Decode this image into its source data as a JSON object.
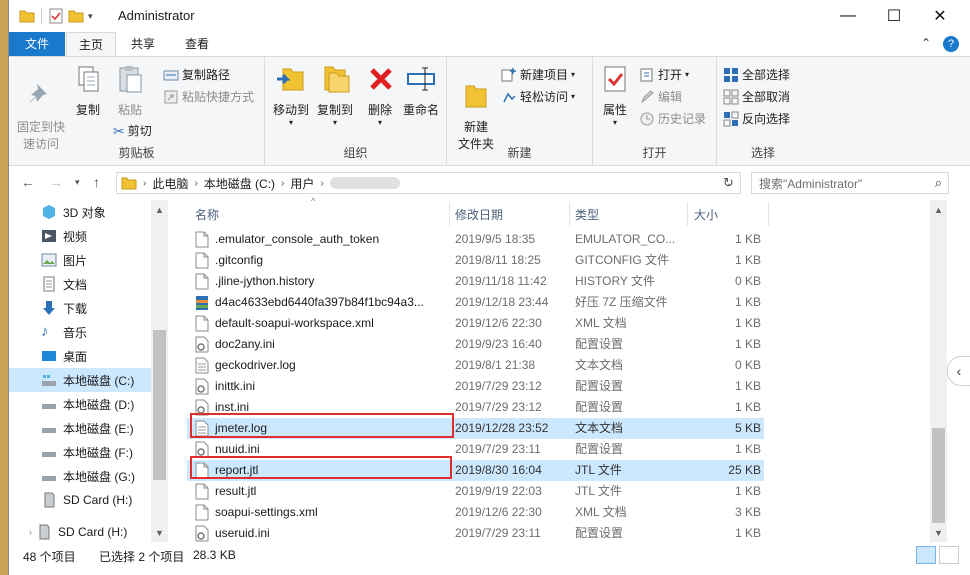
{
  "window": {
    "title": "Administrator",
    "minimize": "—",
    "maximize": "☐",
    "close": "✕"
  },
  "ribbon_tabs": {
    "file": "文件",
    "home": "主页",
    "share": "共享",
    "view": "查看"
  },
  "ribbon": {
    "clipboard": {
      "label": "剪贴板",
      "pin": "固定到快\n速访问",
      "copy": "复制",
      "paste": "粘贴",
      "copy_path": "复制路径",
      "paste_shortcut": "粘贴快捷方式",
      "cut": "剪切"
    },
    "organize": {
      "label": "组织",
      "move_to": "移动到",
      "copy_to": "复制到",
      "delete": "删除",
      "rename": "重命名"
    },
    "new": {
      "label": "新建",
      "new_folder": "新建\n文件夹",
      "new_item": "新建项目",
      "easy_access": "轻松访问"
    },
    "open": {
      "label": "打开",
      "properties": "属性",
      "open": "打开",
      "edit": "编辑",
      "history": "历史记录"
    },
    "select": {
      "label": "选择",
      "select_all": "全部选择",
      "select_none": "全部取消",
      "invert": "反向选择"
    }
  },
  "address": {
    "crumbs": [
      "此电脑",
      "本地磁盘 (C:)",
      "用户"
    ],
    "search_placeholder": "搜索\"Administrator\""
  },
  "nav_items": [
    {
      "label": "3D 对象",
      "icon": "3d-objects-icon"
    },
    {
      "label": "视频",
      "icon": "video-folder-icon"
    },
    {
      "label": "图片",
      "icon": "pictures-folder-icon"
    },
    {
      "label": "文档",
      "icon": "documents-folder-icon"
    },
    {
      "label": "下载",
      "icon": "downloads-folder-icon"
    },
    {
      "label": "音乐",
      "icon": "music-folder-icon"
    },
    {
      "label": "桌面",
      "icon": "desktop-folder-icon"
    },
    {
      "label": "本地磁盘 (C:)",
      "icon": "drive-c-icon"
    },
    {
      "label": "本地磁盘 (D:)",
      "icon": "drive-icon"
    },
    {
      "label": "本地磁盘 (E:)",
      "icon": "drive-icon"
    },
    {
      "label": "本地磁盘 (F:)",
      "icon": "drive-icon"
    },
    {
      "label": "本地磁盘 (G:)",
      "icon": "drive-icon"
    },
    {
      "label": "SD Card (H:)",
      "icon": "sd-card-icon"
    },
    {
      "label": "SD Card (H:)",
      "icon": "sd-card-icon"
    }
  ],
  "columns": {
    "name": "名称",
    "date": "修改日期",
    "type": "类型",
    "size": "大小"
  },
  "files": [
    {
      "name": ".emulator_console_auth_token",
      "date": "2019/9/5 18:35",
      "type": "EMULATOR_CO...",
      "size": "1 KB",
      "icon": "file-icon"
    },
    {
      "name": ".gitconfig",
      "date": "2019/8/11 18:25",
      "type": "GITCONFIG 文件",
      "size": "1 KB",
      "icon": "file-icon"
    },
    {
      "name": ".jline-jython.history",
      "date": "2019/11/18 11:42",
      "type": "HISTORY 文件",
      "size": "0 KB",
      "icon": "file-icon"
    },
    {
      "name": "d4ac4633ebd6440fa397b84f1bc94a3...",
      "date": "2019/12/18 23:44",
      "type": "好压 7Z 压缩文件",
      "size": "1 KB",
      "icon": "archive-icon"
    },
    {
      "name": "default-soapui-workspace.xml",
      "date": "2019/12/6 22:30",
      "type": "XML 文档",
      "size": "1 KB",
      "icon": "file-icon"
    },
    {
      "name": "doc2any.ini",
      "date": "2019/9/23 16:40",
      "type": "配置设置",
      "size": "1 KB",
      "icon": "ini-file-icon"
    },
    {
      "name": "geckodriver.log",
      "date": "2019/8/1 21:38",
      "type": "文本文档",
      "size": "0 KB",
      "icon": "text-file-icon"
    },
    {
      "name": "inittk.ini",
      "date": "2019/7/29 23:12",
      "type": "配置设置",
      "size": "1 KB",
      "icon": "ini-file-icon"
    },
    {
      "name": "inst.ini",
      "date": "2019/7/29 23:12",
      "type": "配置设置",
      "size": "1 KB",
      "icon": "ini-file-icon"
    },
    {
      "name": "jmeter.log",
      "date": "2019/12/28 23:52",
      "type": "文本文档",
      "size": "5 KB",
      "icon": "text-file-icon",
      "selected": true
    },
    {
      "name": "nuuid.ini",
      "date": "2019/7/29 23:11",
      "type": "配置设置",
      "size": "1 KB",
      "icon": "ini-file-icon"
    },
    {
      "name": "report.jtl",
      "date": "2019/8/30 16:04",
      "type": "JTL 文件",
      "size": "25 KB",
      "icon": "file-icon",
      "selected": true
    },
    {
      "name": "result.jtl",
      "date": "2019/9/19 22:03",
      "type": "JTL 文件",
      "size": "1 KB",
      "icon": "file-icon"
    },
    {
      "name": "soapui-settings.xml",
      "date": "2019/12/6 22:30",
      "type": "XML 文档",
      "size": "3 KB",
      "icon": "file-icon"
    },
    {
      "name": "useruid.ini",
      "date": "2019/7/29 23:11",
      "type": "配置设置",
      "size": "1 KB",
      "icon": "ini-file-icon"
    }
  ],
  "status": {
    "count": "48 个项目",
    "selected": "已选择 2 个项目",
    "size": "28.3 KB"
  },
  "colors": {
    "accent": "#1979ca",
    "selection": "#cce8ff",
    "highlight_box": "#e02d2d"
  }
}
